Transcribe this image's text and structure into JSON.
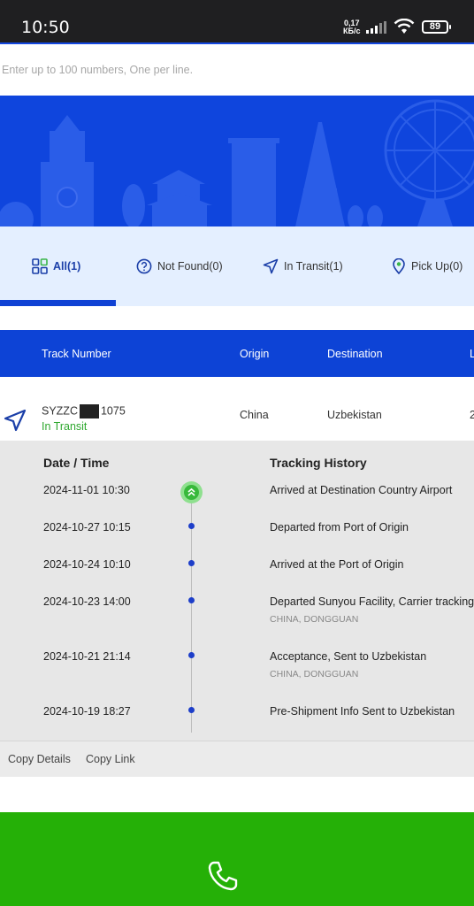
{
  "statusbar": {
    "time": "10:50",
    "net_speed": "0,17",
    "net_unit": "КБ/с",
    "battery": "89"
  },
  "search": {
    "placeholder": "Enter up to 100 numbers, One per line."
  },
  "tabs": [
    {
      "label": "All(1)",
      "icon": "grid-icon",
      "active": true
    },
    {
      "label": "Not Found(0)",
      "icon": "question-circle-icon",
      "active": false
    },
    {
      "label": "In Transit(1)",
      "icon": "navigation-arrow-icon",
      "active": false
    },
    {
      "label": "Pick Up(0)",
      "icon": "map-pin-icon",
      "active": false
    }
  ],
  "table": {
    "headers": [
      "Track Number",
      "Origin",
      "Destination",
      "L"
    ],
    "row": {
      "track_prefix": "SYZZC",
      "track_suffix": "1075",
      "status": "In Transit",
      "origin": "China",
      "destination": "Uzbekistan",
      "last_col": "2"
    }
  },
  "history": {
    "date_header": "Date / Time",
    "title_header": "Tracking History",
    "events": [
      {
        "date": "2024-11-01 10:30",
        "description": "Arrived at Destination Country Airport",
        "location": ""
      },
      {
        "date": "2024-10-27 10:15",
        "description": "Departed from Port of Origin",
        "location": ""
      },
      {
        "date": "2024-10-24 10:10",
        "description": "Arrived at the Port of Origin",
        "location": ""
      },
      {
        "date": "2024-10-23 14:00",
        "description": "Departed Sunyou Facility, Carrier tracking",
        "location": "CHINA, DONGGUAN"
      },
      {
        "date": "2024-10-21 21:14",
        "description": "Acceptance, Sent to Uzbekistan",
        "location": "CHINA, DONGGUAN"
      },
      {
        "date": "2024-10-19 18:27",
        "description": "Pre-Shipment Info Sent to Uzbekistan",
        "location": ""
      }
    ]
  },
  "actions": {
    "copy_details": "Copy Details",
    "copy_link": "Copy Link"
  },
  "colors": {
    "brand_blue": "#0d43d6",
    "transit_green": "#2fa82f",
    "call_green": "#25b007"
  }
}
